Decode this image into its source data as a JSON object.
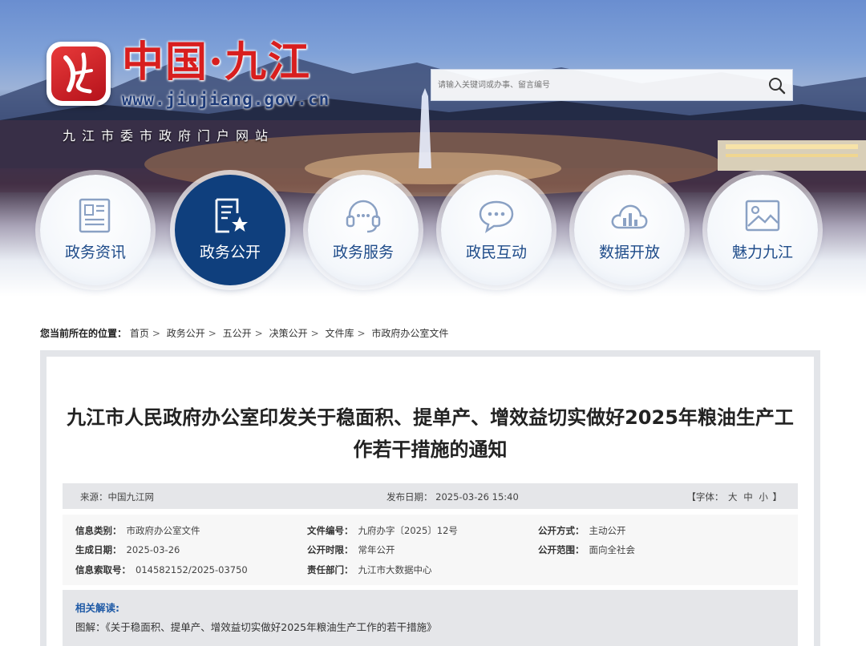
{
  "header": {
    "logo_title": "中国·九江",
    "logo_url": "www.jiujiang.gov.cn",
    "logo_subtitle": "九江市委市政府门户网站",
    "search_placeholder": "请输入关键词或办事、留言编号"
  },
  "nav": [
    {
      "label": "政务资讯",
      "icon": "newspaper-icon",
      "active": false
    },
    {
      "label": "政务公开",
      "icon": "document-star-icon",
      "active": true
    },
    {
      "label": "政务服务",
      "icon": "headset-icon",
      "active": false
    },
    {
      "label": "政民互动",
      "icon": "chat-bubble-icon",
      "active": false
    },
    {
      "label": "数据开放",
      "icon": "cloud-chart-icon",
      "active": false
    },
    {
      "label": "魅力九江",
      "icon": "picture-icon",
      "active": false
    }
  ],
  "breadcrumb": {
    "prefix": "您当前所在的位置：",
    "items": [
      "首页",
      "政务公开",
      "五公开",
      "决策公开",
      "文件库",
      "市政府办公室文件"
    ]
  },
  "article": {
    "title_line1": "九江市人民政府办公室印发关于稳面积、提单产、增效益切实做好2025年粮油生产工",
    "title_line2": "作若干措施的通知",
    "source": "来源：中国九江网",
    "publish_date": "发布日期：  2025-03-26 15:40",
    "font_label": "【字体：",
    "font_large": "大",
    "font_medium": "中",
    "font_small": "小",
    "font_close": "】",
    "info": {
      "category_k": "信息类别：",
      "category_v": "市政府办公室文件",
      "docno_k": "文件编号：",
      "docno_v": "九府办字〔2025〕12号",
      "method_k": "公开方式：",
      "method_v": "主动公开",
      "gendate_k": "生成日期：",
      "gendate_v": "2025-03-26",
      "period_k": "公开时限：",
      "period_v": "常年公开",
      "scope_k": "公开范围：",
      "scope_v": "面向全社会",
      "index_k": "信息索取号：",
      "index_v": "014582152/2025-03750",
      "dept_k": "责任部门：",
      "dept_v": "九江市大数据中心"
    },
    "related_heading": "相关解读:",
    "related_link": "图解：《关于稳面积、提单产、增效益切实做好2025年粮油生产工作的若干措施》"
  },
  "colors": {
    "brand_red": "#d81e1e",
    "nav_active": "#0f3f7d",
    "nav_text": "#1f4c8a",
    "link_blue": "#1f5aa6"
  }
}
